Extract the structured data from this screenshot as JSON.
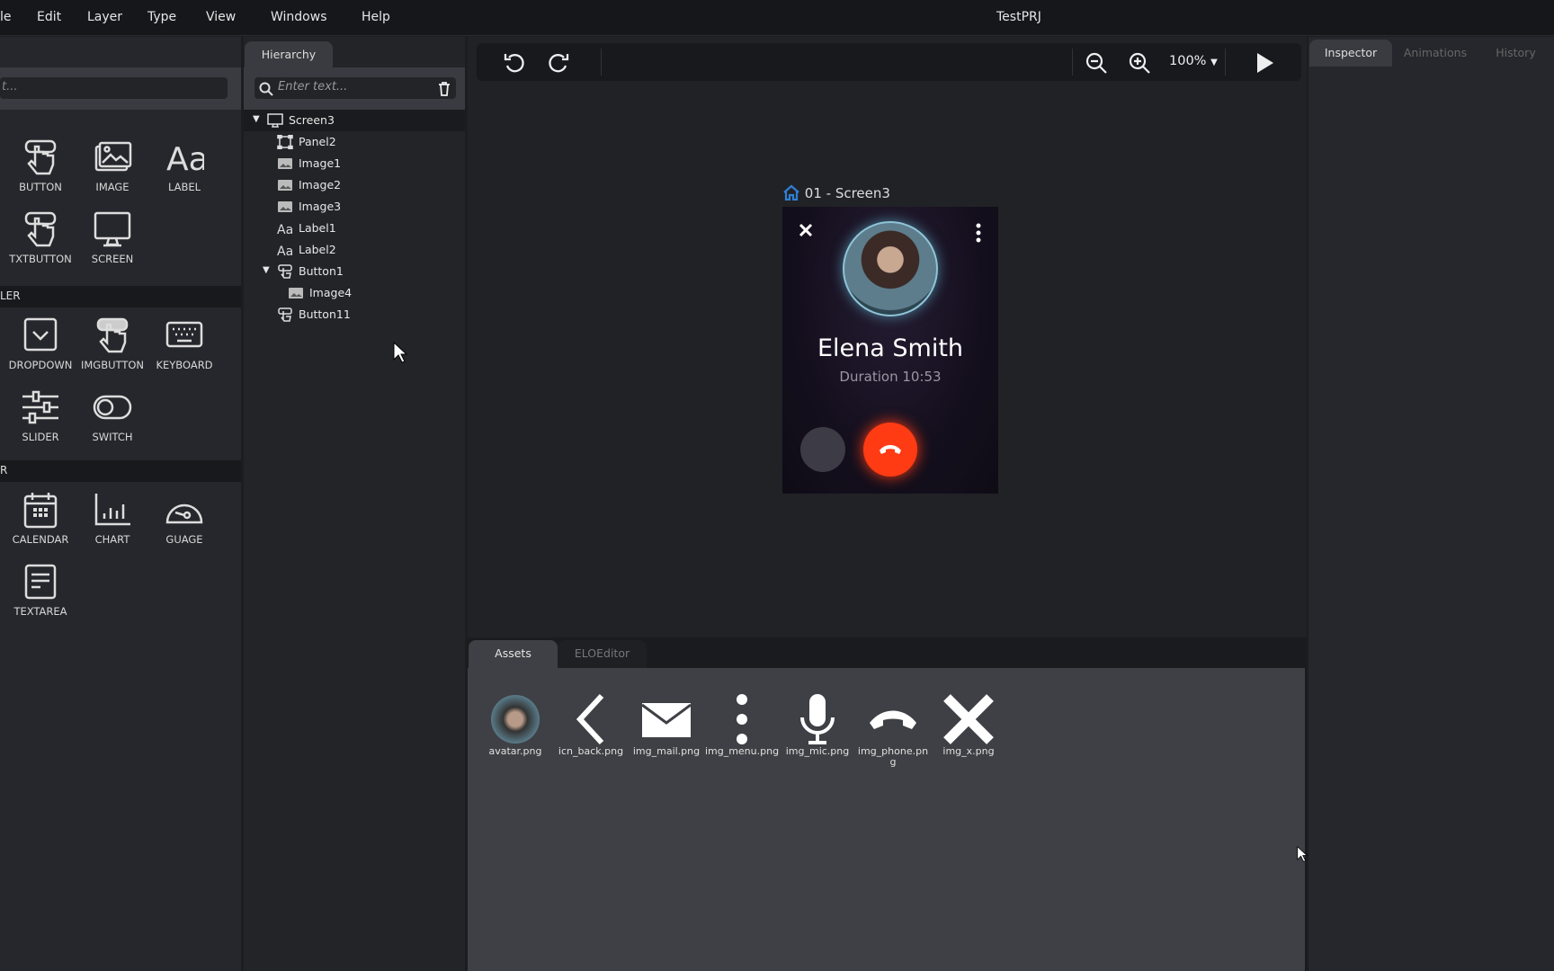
{
  "window": {
    "title": "TestPRJ"
  },
  "menu": [
    "le",
    "Edit",
    "Layer",
    "Type",
    "View",
    "Windows",
    "Help"
  ],
  "widgets": {
    "search_placeholder": "t...",
    "basic": [
      {
        "label": "BUTTON",
        "icon": "hand-pointer-icon"
      },
      {
        "label": "IMAGE",
        "icon": "image-icon"
      },
      {
        "label": "LABEL",
        "icon": "text-aa-icon"
      },
      {
        "label": "TXTBUTTON",
        "icon": "hand-pointer-icon"
      },
      {
        "label": "SCREEN",
        "icon": "monitor-icon"
      }
    ],
    "section2": "LER",
    "controller": [
      {
        "label": "DROPDOWN",
        "icon": "dropdown-icon"
      },
      {
        "label": "IMGBUTTON",
        "icon": "hand-pointer-icon"
      },
      {
        "label": "KEYBOARD",
        "icon": "keyboard-icon"
      },
      {
        "label": "SLIDER",
        "icon": "sliders-icon"
      },
      {
        "label": "SWITCH",
        "icon": "toggle-icon"
      }
    ],
    "section3": "R",
    "other": [
      {
        "label": "CALENDAR",
        "icon": "calendar-icon"
      },
      {
        "label": "CHART",
        "icon": "bar-chart-icon"
      },
      {
        "label": "GUAGE",
        "icon": "gauge-icon"
      },
      {
        "label": "TEXTAREA",
        "icon": "textarea-icon"
      }
    ]
  },
  "hierarchy": {
    "tab": "Hierarchy",
    "search_placeholder": "Enter text...",
    "items": [
      {
        "label": "Screen3",
        "icon": "monitor-icon",
        "depth": 0,
        "expanded": true
      },
      {
        "label": "Panel2",
        "icon": "panel-icon",
        "depth": 1
      },
      {
        "label": "Image1",
        "icon": "image-icon",
        "depth": 1
      },
      {
        "label": "Image2",
        "icon": "image-icon",
        "depth": 1
      },
      {
        "label": "Image3",
        "icon": "image-icon",
        "depth": 1
      },
      {
        "label": "Label1",
        "icon": "text-aa-icon",
        "depth": 1
      },
      {
        "label": "Label2",
        "icon": "text-aa-icon",
        "depth": 1
      },
      {
        "label": "Button1",
        "icon": "button-icon",
        "depth": 1,
        "expanded": true
      },
      {
        "label": "Image4",
        "icon": "image-icon",
        "depth": 2
      },
      {
        "label": "Button11",
        "icon": "button-icon",
        "depth": 1
      }
    ]
  },
  "toolbar": {
    "zoom": "100%"
  },
  "preview": {
    "screen_label": "01 - Screen3",
    "name": "Elena Smith",
    "duration": "Duration 10:53",
    "end_call_color": "#ff3b14",
    "accent": "#2f7fd6"
  },
  "bottom": {
    "tabs": [
      "Assets",
      "ELOEditor"
    ],
    "assets": [
      {
        "name": "avatar.png",
        "icon": "avatar-image"
      },
      {
        "name": "icn_back.png",
        "icon": "chevron-left-icon"
      },
      {
        "name": "img_mail.png",
        "icon": "mail-icon"
      },
      {
        "name": "img_menu.png",
        "icon": "kebab-menu-icon"
      },
      {
        "name": "img_mic.png",
        "icon": "microphone-icon"
      },
      {
        "name": "img_phone.png",
        "icon": "phone-hangup-icon"
      },
      {
        "name": "img_x.png",
        "icon": "x-icon"
      }
    ]
  },
  "right": {
    "tabs": [
      "Inspector",
      "Animations",
      "History"
    ]
  }
}
